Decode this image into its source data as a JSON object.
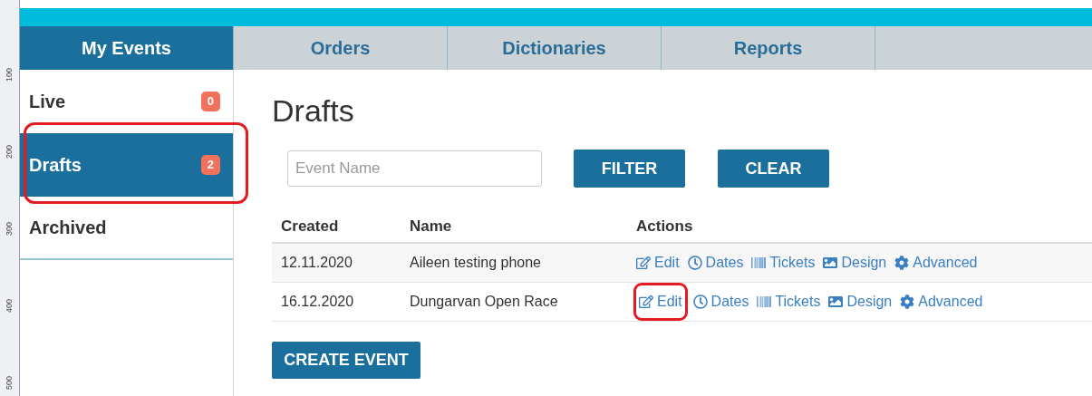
{
  "ruler": {
    "labels": [
      "100",
      "200",
      "300",
      "400",
      "500"
    ]
  },
  "tabs": [
    {
      "label": "My Events",
      "selected": true
    },
    {
      "label": "Orders",
      "selected": false
    },
    {
      "label": "Dictionaries",
      "selected": false
    },
    {
      "label": "Reports",
      "selected": false
    }
  ],
  "sidebar": {
    "items": [
      {
        "label": "Live",
        "count": "0",
        "selected": false,
        "highlighted": false
      },
      {
        "label": "Drafts",
        "count": "2",
        "selected": true,
        "highlighted": true
      },
      {
        "label": "Archived",
        "selected": false,
        "highlighted": false
      }
    ]
  },
  "page_title": "Drafts",
  "filter": {
    "placeholder": "Event Name",
    "buttons": [
      "FILTER",
      "CLEAR"
    ]
  },
  "table": {
    "columns": [
      "Created",
      "Name",
      "Actions"
    ],
    "rows": [
      {
        "created": "12.11.2020",
        "name": "Aileen testing phone",
        "actions": [
          {
            "kind": "edit",
            "label": "Edit",
            "highlighted": false
          },
          {
            "kind": "dates",
            "label": "Dates",
            "highlighted": false
          },
          {
            "kind": "tickets",
            "label": "Tickets",
            "highlighted": false
          },
          {
            "kind": "design",
            "label": "Design",
            "highlighted": false
          },
          {
            "kind": "advanced",
            "label": "Advanced",
            "highlighted": false
          }
        ]
      },
      {
        "created": "16.12.2020",
        "name": "Dungarvan Open Race",
        "actions": [
          {
            "kind": "edit",
            "label": "Edit",
            "highlighted": true
          },
          {
            "kind": "dates",
            "label": "Dates",
            "highlighted": false
          },
          {
            "kind": "tickets",
            "label": "Tickets",
            "highlighted": false
          },
          {
            "kind": "design",
            "label": "Design",
            "highlighted": false
          },
          {
            "kind": "advanced",
            "label": "Advanced",
            "highlighted": false
          }
        ]
      }
    ]
  },
  "create_button": "CREATE EVENT"
}
